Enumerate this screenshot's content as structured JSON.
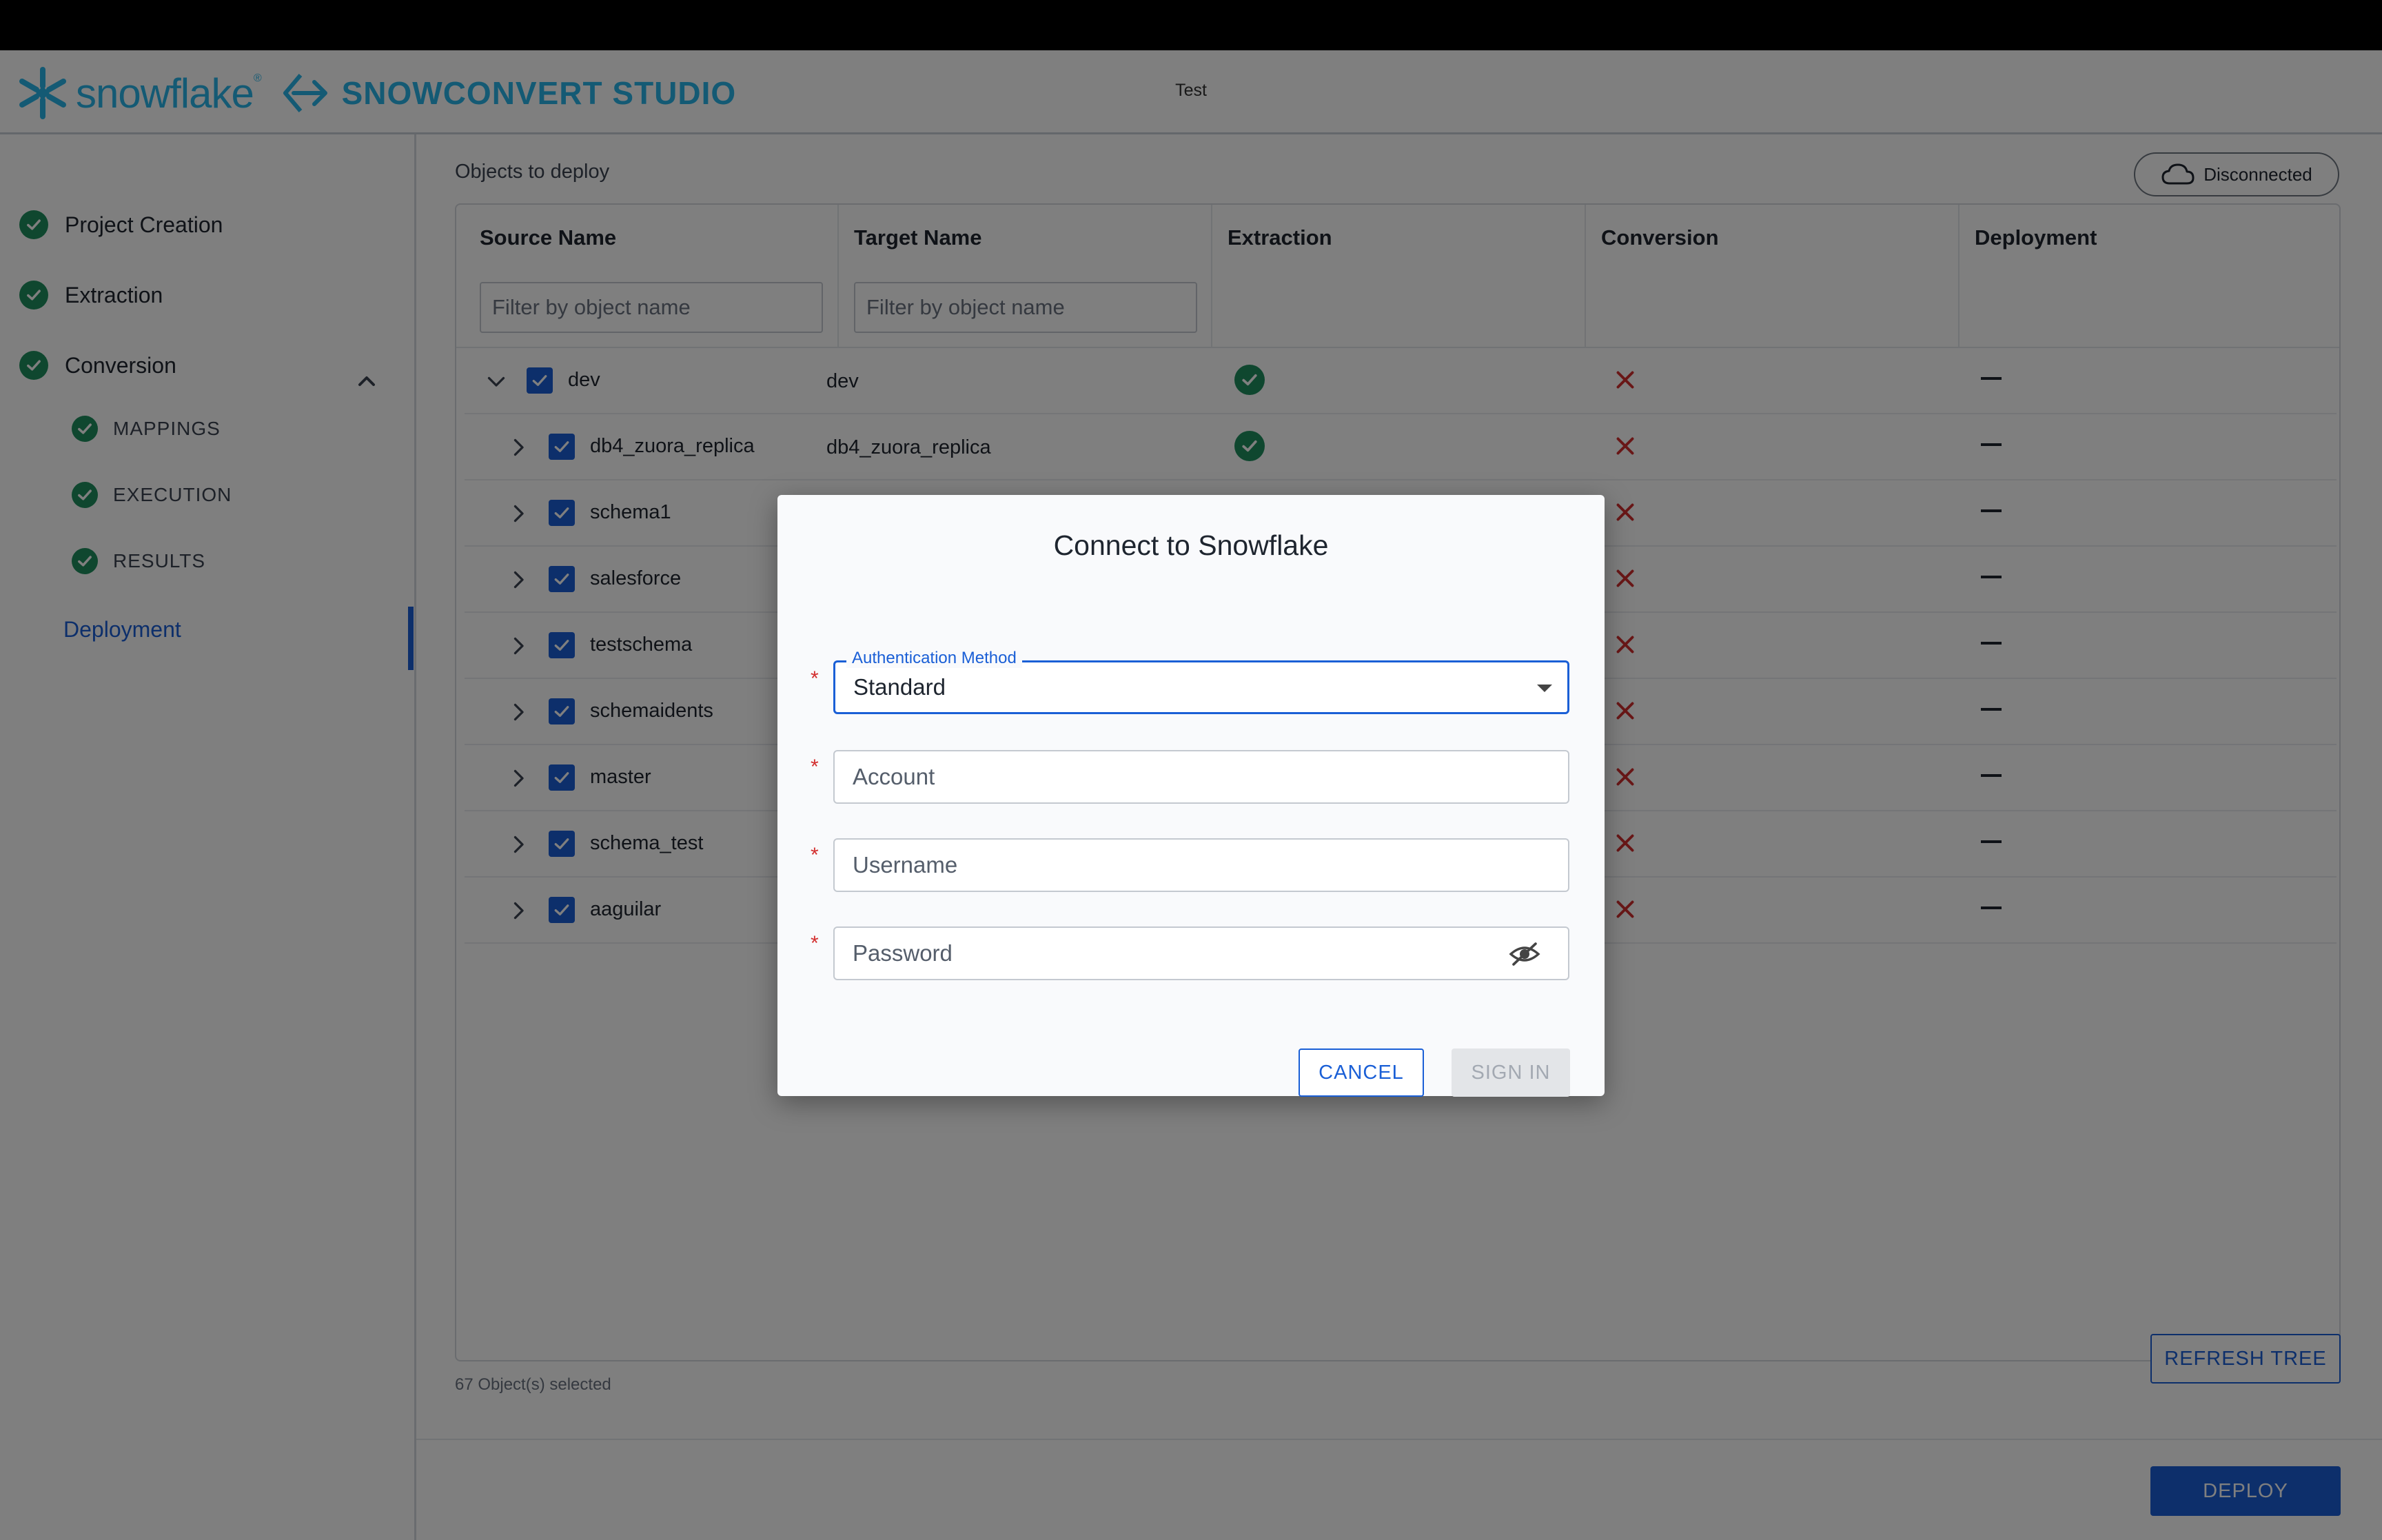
{
  "header": {
    "brand": "snowflake",
    "product": "SNOWCONVERT STUDIO",
    "project_name": "Test"
  },
  "sidebar": {
    "items": [
      {
        "label": "Project Creation",
        "status": "complete"
      },
      {
        "label": "Extraction",
        "status": "complete"
      },
      {
        "label": "Conversion",
        "status": "complete",
        "expanded": true,
        "children": [
          {
            "label": "MAPPINGS",
            "status": "complete"
          },
          {
            "label": "EXECUTION",
            "status": "complete"
          },
          {
            "label": "RESULTS",
            "status": "complete"
          }
        ]
      },
      {
        "label": "Deployment",
        "status": "active"
      }
    ]
  },
  "main": {
    "section_title": "Objects to deploy",
    "connection_status": "Disconnected",
    "table": {
      "columns": [
        "Source Name",
        "Target Name",
        "Extraction",
        "Conversion",
        "Deployment"
      ],
      "filter_placeholder": "Filter by object name",
      "rows": [
        {
          "source": "dev",
          "target": "dev",
          "expanded": true,
          "extraction": "success",
          "conversion": "failed",
          "deployment": "none"
        },
        {
          "source": "db4_zuora_replica",
          "target": "db4_zuora_replica",
          "extraction": "success",
          "conversion": "failed",
          "deployment": "none"
        },
        {
          "source": "schema1",
          "target": "",
          "conversion": "failed",
          "deployment": "none"
        },
        {
          "source": "salesforce",
          "target": "",
          "conversion": "failed",
          "deployment": "none"
        },
        {
          "source": "testschema",
          "target": "",
          "conversion": "failed",
          "deployment": "none"
        },
        {
          "source": "schemaidents",
          "target": "",
          "conversion": "failed",
          "deployment": "none"
        },
        {
          "source": "master",
          "target": "",
          "conversion": "failed",
          "deployment": "none"
        },
        {
          "source": "schema_test",
          "target": "",
          "conversion": "failed",
          "deployment": "none"
        },
        {
          "source": "aaguilar",
          "target": "",
          "conversion": "failed",
          "deployment": "none"
        }
      ]
    },
    "selected_count": "67 Object(s) selected",
    "refresh_label": "REFRESH TREE",
    "deploy_label": "DEPLOY"
  },
  "dialog": {
    "title": "Connect to Snowflake",
    "auth_method_label": "Authentication Method",
    "auth_method_value": "Standard",
    "account_placeholder": "Account",
    "username_placeholder": "Username",
    "password_placeholder": "Password",
    "required_mark": "*",
    "cancel_label": "CANCEL",
    "signin_label": "SIGN IN"
  },
  "colors": {
    "accent": "#1a5fd6",
    "success": "#1e8f5e",
    "error": "#d32f2f",
    "brand": "#29b5e8"
  },
  "icons": [
    "snowflake-logo-icon",
    "snowconvert-logo-icon",
    "check-circle-icon",
    "chevron-up-icon",
    "cloud-icon",
    "chevron-down-icon",
    "chevron-right-icon",
    "checkbox-checked-icon",
    "close-x-icon",
    "dash-icon",
    "dropdown-caret-icon",
    "eye-off-icon"
  ]
}
